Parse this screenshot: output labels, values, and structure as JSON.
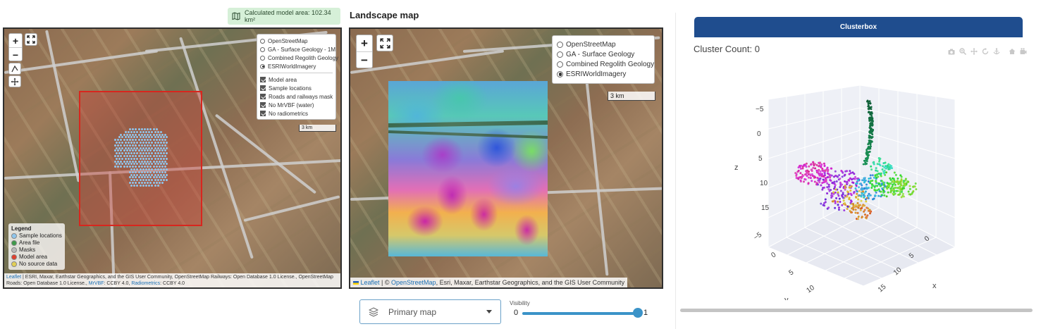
{
  "badge": {
    "text": "Calculated model area:  102.34 km²",
    "icon": "map-icon"
  },
  "landscape_title": "Landscape map",
  "left_map": {
    "zoom_in": "+",
    "zoom_out": "−",
    "layers": {
      "base": [
        {
          "label": "OpenStreetMap",
          "selected": false
        },
        {
          "label": "GA - Surface Geology - 1M",
          "selected": false
        },
        {
          "label": "Combined Regolith Geology",
          "selected": false
        },
        {
          "label": "ESRIWorldImagery",
          "selected": true
        }
      ],
      "overlays": [
        {
          "label": "Model area",
          "checked": true
        },
        {
          "label": "Sample locations",
          "checked": true
        },
        {
          "label": "Roads and railways mask",
          "checked": true
        },
        {
          "label": "No MrVBF (water)",
          "checked": true
        },
        {
          "label": "No radiometrics",
          "checked": true
        }
      ]
    },
    "scale": "3 km",
    "legend": {
      "title": "Legend",
      "items": [
        {
          "label": "Sample locations",
          "color": "#8fc6ec"
        },
        {
          "label": "Area file",
          "color": "#3e9a4a"
        },
        {
          "label": "Masks",
          "color": "#b8b8b8"
        },
        {
          "label": "Model area",
          "color": "#e0402e"
        },
        {
          "label": "No source data",
          "color": "#e2cf55"
        }
      ]
    },
    "attribution": {
      "leaflet": "Leaflet",
      "line1": " | ESRI, Maxar, Earthstar Geographics, and the GIS User Community, OpenStreetMap Railways: Open Database 1.0 License., OpenStreetMap",
      "line2a": "Roads: Open Database 1.0 License., ",
      "mrvbf": "MrVBF",
      "line2b": ": CCBY 4.0, ",
      "radiometrics": "Radiometrics",
      "line2c": ": CCBY 4.0"
    }
  },
  "right_map": {
    "zoom_in": "+",
    "zoom_out": "−",
    "layers": [
      {
        "label": "OpenStreetMap",
        "selected": false
      },
      {
        "label": "GA - Surface Geology",
        "selected": false
      },
      {
        "label": "Combined Regolith Geology",
        "selected": false
      },
      {
        "label": "ESRIWorldImagery",
        "selected": true
      }
    ],
    "scale": "3 km",
    "attribution": {
      "leaflet": "Leaflet",
      "sep": " | © ",
      "osm": "OpenStreetMap",
      "rest": ", Esri, Maxar, Earthstar Geographics, and the GIS User Community"
    }
  },
  "controls": {
    "select_value": "Primary map",
    "select_icon": "layers-icon",
    "visibility_label": "Visibility",
    "slider_min": "0",
    "slider_max": "1",
    "slider_value": 1
  },
  "cluster": {
    "header": "Clusterbox",
    "count_label": "Cluster Count: 0",
    "modebar_icons": [
      "camera-icon",
      "zoom-icon",
      "pan-icon",
      "orbit-icon",
      "turntable-icon",
      "home-icon",
      "reset-camera-icon"
    ],
    "colors": {
      "header": "#1f4d8e"
    }
  },
  "chart_data": {
    "type": "scatter",
    "title": "",
    "axes": {
      "x": {
        "label": "x",
        "ticks": [
          "0",
          "5",
          "10",
          "15"
        ]
      },
      "y": {
        "label": "y",
        "ticks": [
          "−5",
          "0",
          "5",
          "10",
          "15"
        ]
      },
      "z": {
        "label": "z",
        "ticks": [
          "−5",
          "0",
          "5",
          "10",
          "15"
        ]
      }
    },
    "grid": true,
    "legend": "none"
  }
}
